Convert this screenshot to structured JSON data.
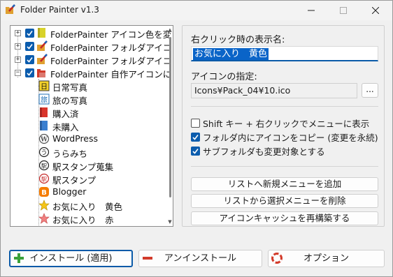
{
  "window": {
    "title": "Folder Painter v1.3",
    "icon": "paintbrush-folder-icon"
  },
  "tree": {
    "items": [
      {
        "label": "FolderPainter アイコン色を変",
        "expandable": true,
        "expander": "+",
        "checked": true,
        "icon": "yellow-folder-icon"
      },
      {
        "label": "FolderPainter フォルダアイコ",
        "expandable": true,
        "expander": "+",
        "checked": true,
        "icon": "brush-folder-icon"
      },
      {
        "label": "FolderPainter フォルダアイコン",
        "expandable": true,
        "expander": "+",
        "checked": true,
        "icon": "brush-folder-icon"
      },
      {
        "label": "FolderPainter 自作アイコンに",
        "expandable": true,
        "expander": "−",
        "checked": true,
        "icon": "red-folder-icon"
      },
      {
        "label": "日常写真",
        "icon": "nichi-kanji-icon"
      },
      {
        "label": "旅の写真",
        "icon": "tabi-kanji-icon"
      },
      {
        "label": "購入済",
        "icon": "red-book-icon"
      },
      {
        "label": "未購入",
        "icon": "blue-book-icon"
      },
      {
        "label": "WordPress",
        "icon": "wordpress-icon"
      },
      {
        "label": "うらみち",
        "icon": "circle-u-icon"
      },
      {
        "label": "駅スタンプ蒐集",
        "icon": "eki-stamp-icon"
      },
      {
        "label": "駅スタンプ",
        "icon": "eki-stamp-red-icon"
      },
      {
        "label": "Blogger",
        "icon": "blogger-icon"
      },
      {
        "label": "お気に入り　黄色",
        "icon": "yellow-star-icon"
      },
      {
        "label": "お気に入り　赤",
        "icon": "red-star-icon"
      }
    ]
  },
  "panel": {
    "menu_name_label": "右クリック時の表示名:",
    "menu_name_value": "お気に入り　黄色",
    "icon_label": "アイコンの指定:",
    "icon_path": "Icons¥Pack_04¥10.ico",
    "browse_label": "...",
    "options": [
      {
        "label": "Shift キー + 右クリックでメニューに表示",
        "checked": false
      },
      {
        "label": "フォルダ内にアイコンをコピー (変更を永続)",
        "checked": true
      },
      {
        "label": "サブフォルダも変更対象とする",
        "checked": true
      }
    ],
    "add_menu_label": "リストへ新規メニューを追加",
    "delete_menu_label": "リストから選択メニューを削除",
    "rebuild_cache_label": "アイコンキャッシュを再構築する"
  },
  "footer": {
    "install_label": "インストール (適用)",
    "uninstall_label": "アンインストール",
    "options_label": "オプション"
  },
  "colors": {
    "accent": "#0a5aa8",
    "selection": "#0a64c8"
  }
}
